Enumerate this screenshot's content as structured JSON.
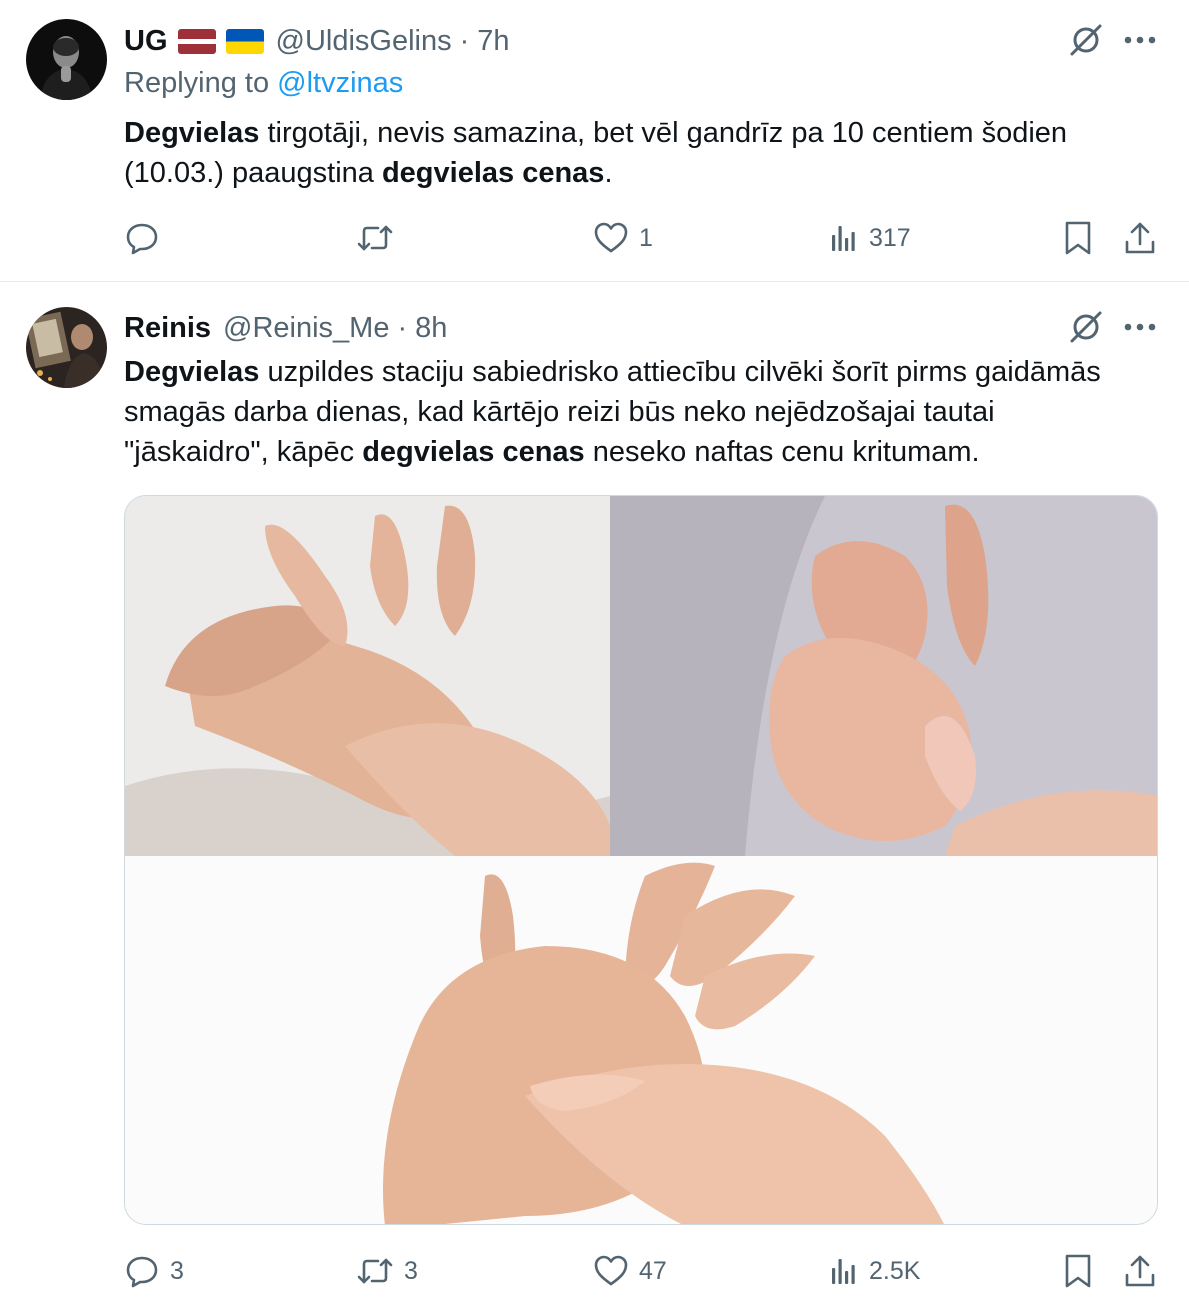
{
  "tweets": [
    {
      "name": "UG",
      "handle": "@UldisGelins",
      "dot": "·",
      "time": "7h",
      "replying_prefix": "Replying to",
      "replying_to": "@ltvzinas",
      "text_parts": [
        {
          "t": "Degvielas",
          "b": true
        },
        {
          "t": " tirgotāji, nevis samazina, bet vēl gandrīz pa 10 centiem šodien (10.03.) paaugstina ",
          "b": false
        },
        {
          "t": "degvielas cenas",
          "b": true
        },
        {
          "t": ".",
          "b": false
        }
      ],
      "actions": {
        "replies": "",
        "retweets": "",
        "likes": "1",
        "views": "317"
      }
    },
    {
      "name": "Reinis",
      "handle": "@Reinis_Me",
      "dot": "·",
      "time": "8h",
      "text_parts": [
        {
          "t": "Degvielas",
          "b": true
        },
        {
          "t": " uzpildes staciju sabiedrisko attiecību cilvēki šorīt pirms gaidāmās smagās darba dienas, kad kārtējo reizi būs neko nejēdzošajai tautai \"jāskaidro\", kāpēc ",
          "b": false
        },
        {
          "t": "degvielas cenas",
          "b": true
        },
        {
          "t": " neseko naftas cenu kritumam.",
          "b": false
        }
      ],
      "actions": {
        "replies": "3",
        "retweets": "3",
        "likes": "47",
        "views": "2.5K"
      }
    }
  ],
  "icons": {
    "flag1": "latvia-flag-icon",
    "flag2": "ukraine-flag-icon",
    "grok": "grok-icon",
    "more": "more-icon",
    "reply": "reply-icon",
    "retweet": "retweet-icon",
    "like": "heart-icon",
    "views": "views-icon",
    "bookmark": "bookmark-icon",
    "share": "share-icon"
  },
  "colors": {
    "text": "#0f1419",
    "secondary": "#536471",
    "link": "#1d9bf0",
    "border": "#cfd9de"
  }
}
